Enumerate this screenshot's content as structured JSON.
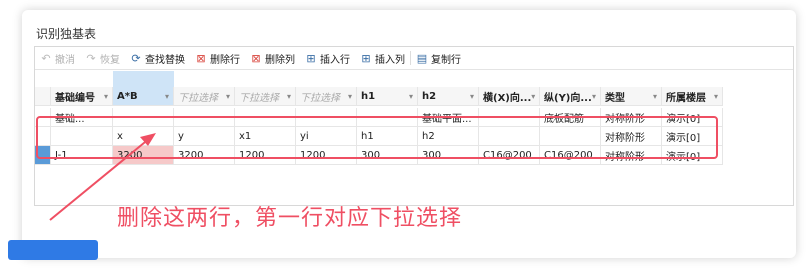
{
  "dialog": {
    "title": "识别独基表"
  },
  "toolbar": {
    "undo": "撤消",
    "redo": "恢复",
    "find_replace": "查找替换",
    "delete_row": "删除行",
    "delete_col": "删除列",
    "insert_row": "插入行",
    "insert_col": "插入列",
    "copy_row": "复制行"
  },
  "table": {
    "headers": [
      {
        "label": "基础编号",
        "placeholder": false
      },
      {
        "label": "A*B",
        "placeholder": false,
        "selected": true
      },
      {
        "label": "下拉选择",
        "placeholder": true
      },
      {
        "label": "下拉选择",
        "placeholder": true
      },
      {
        "label": "下拉选择",
        "placeholder": true
      },
      {
        "label": "h1",
        "placeholder": false
      },
      {
        "label": "h2",
        "placeholder": false
      },
      {
        "label": "横(X)向...",
        "placeholder": false
      },
      {
        "label": "纵(Y)向...",
        "placeholder": false
      },
      {
        "label": "类型",
        "placeholder": false
      },
      {
        "label": "所属楼层",
        "placeholder": false
      }
    ],
    "rows": [
      [
        "基础...",
        "",
        "",
        "",
        "",
        "",
        "基础平面...",
        "",
        "底板配筋",
        "对称阶形",
        "演示[0]"
      ],
      [
        "",
        "x",
        "y",
        "x1",
        "yi",
        "h1",
        "h2",
        "",
        "",
        "对称阶形",
        "演示[0]"
      ],
      [
        "J-1",
        "3200",
        "3200",
        "1200",
        "1200",
        "300",
        "300",
        "C16@200",
        "C16@200",
        "对称阶形",
        "演示[0]"
      ]
    ]
  },
  "annotation": {
    "text": "删除这两行，第一行对应下拉选择",
    "color": "#ef4f63"
  },
  "bottom": {
    "button_label": "",
    "item1": "",
    "item2": "",
    "item3": ""
  }
}
